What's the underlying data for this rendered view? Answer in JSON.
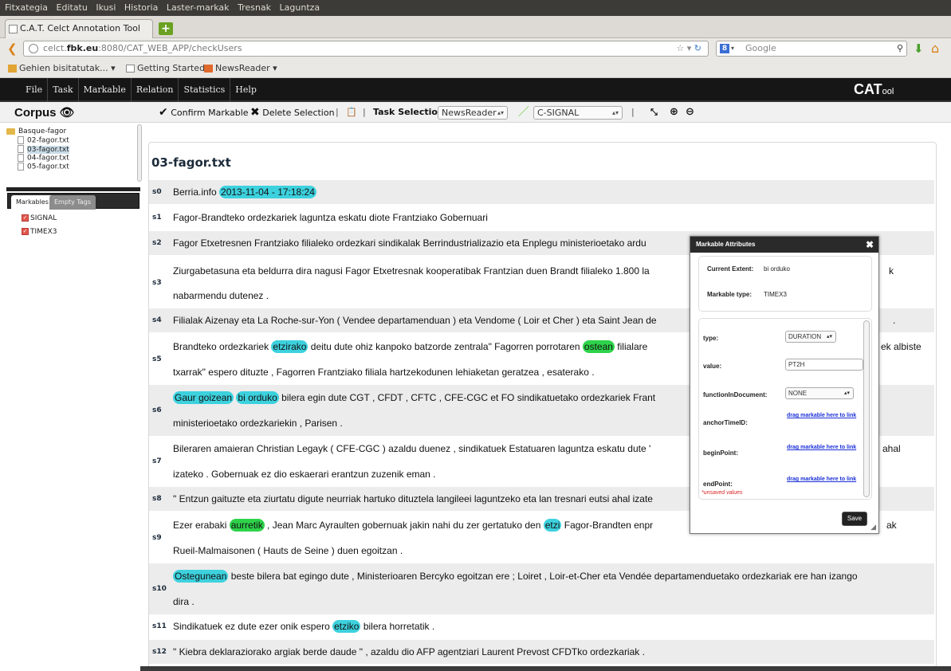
{
  "os_menu": [
    "Fitxategia",
    "Editatu",
    "Ikusi",
    "Historia",
    "Laster-markak",
    "Tresnak",
    "Laguntza"
  ],
  "browser": {
    "tab_title": "C.A.T. Celct Annotation Tool",
    "url_domain": "celct.",
    "url_host_bold": "fbk.eu",
    "url_rest": ":8080/CAT_WEB_APP/checkUsers",
    "search_placeholder": "Google",
    "bookmarks": [
      "Gehien bisitatutak...",
      "Getting Started",
      "NewsReader"
    ]
  },
  "app": {
    "menu": [
      "File",
      "Task",
      "Markable",
      "Relation",
      "Statistics",
      "Help"
    ],
    "logo_main": "CAT",
    "logo_sub": "ool"
  },
  "toolbar": {
    "corpus_label": "Corpus",
    "confirm": "Confirm Markable",
    "delete": "Delete Selection",
    "task_selection_label": "Task Selection",
    "task_value": "NewsReader",
    "markable_value": "C-SIGNAL"
  },
  "tree": {
    "folder": "Basque-fagor",
    "files": [
      "02-fagor.txt",
      "03-fagor.txt",
      "04-fagor.txt",
      "05-fagor.txt"
    ]
  },
  "side_tabs": {
    "markables": "Markables",
    "empty": "Empty Tags"
  },
  "markables": [
    "SIGNAL",
    "TIMEX3"
  ],
  "doc": {
    "title": "03-fagor.txt",
    "sentences": [
      {
        "id": "s0",
        "t1": "Berria.info ",
        "h1": "2013-11-04 - 17:18:24"
      },
      {
        "id": "s1",
        "t1": "Fagor-Brandteko ordezkariek laguntza eskatu diote Frantziako Gobernuari"
      },
      {
        "id": "s2",
        "t1": "Fagor Etxetresnen Frantziako filialeko ordezkari sindikalak Berrindustrializazio eta Enplegu ministerioetako ardu"
      },
      {
        "id": "s3",
        "t1": "Ziurgabetasuna eta beldurra dira nagusi Fagor Etxetresnak kooperatibak Frantzian duen Brandt filialeko 1.800 la",
        "t1b": "k",
        "t2": "nabarmendu dutenez ."
      },
      {
        "id": "s4",
        "t1": "Filialak Aizenay eta La Roche-sur-Yon ( Vendee departamenduan ) eta Vendome ( Loir et Cher ) eta Saint Jean de",
        "t1b": "."
      },
      {
        "id": "s5",
        "a": "Brandteko ordezkariek ",
        "h1": "etzirako",
        "b": " deitu dute ohiz kanpoko batzorde zentrala\" Fagorren porrotaren ",
        "h2": "ostean",
        "c": " filialare",
        "t1b": "ek albiste",
        "t2": "txarrak\" espero dituzte , Fagorren Frantziako filiala hartzekodunen lehiaketan geratzea , esaterako ."
      },
      {
        "id": "s6",
        "h1": "Gaur goizean",
        "h2": "bi orduko",
        "c": " bilera egin dute CGT , CFDT , CFTC , CFE-CGC et FO sindikatuetako ordezkariek Frant",
        "t2": "ministerioetako ordezkariekin , Parisen ."
      },
      {
        "id": "s7",
        "t1": "Bileraren amaieran Christian Legayk ( CFE-CGC ) azaldu duenez , sindikatuek Estatuaren laguntza eskatu dute '",
        "t1b": "ahal",
        "t2": "izateko . Gobernuak ez dio eskaerari erantzun zuzenik eman ."
      },
      {
        "id": "s8",
        "t1": "\" Entzun gaituzte eta ziurtatu digute neurriak hartuko dituztela langileei laguntzeko eta lan tresnari eutsi ahal izate"
      },
      {
        "id": "s9",
        "a": "Ezer erabaki ",
        "h1": "aurretik",
        "b": " , Jean Marc Ayraulten gobernuak jakin nahi du zer gertatuko den ",
        "h2": "etzi",
        "c": " Fagor-Brandten enpr",
        "t1b": "ak",
        "t2": "Rueil-Malmaisonen ( Hauts de Seine ) duen egoitzan ."
      },
      {
        "id": "s10",
        "h1": "Ostegunean",
        "c": " beste bilera bat egingo dute , Ministerioaren Bercyko egoitzan ere ; Loiret , Loir-et-Cher eta Vendée departamenduetako ordezkariak ere han izango",
        "t2": "dira ."
      },
      {
        "id": "s11",
        "a": "Sindikatuek ez dute ezer onik espero ",
        "h1": "etziko",
        "b": " bilera horretatik ."
      },
      {
        "id": "s12",
        "t1": "\" Kiebra deklaraziorako argiak berde daude \" , azaldu dio AFP agentziari Laurent Prevost CFDTko ordezkariak ."
      }
    ]
  },
  "popup": {
    "title": "Markable Attributes",
    "current_extent_label": "Current Extent:",
    "current_extent_value": "bi orduko",
    "markable_type_label": "Markable type:",
    "markable_type_value": "TIMEX3",
    "attributes": {
      "type_label": "type:",
      "type_value": "DURATION",
      "value_label": "value:",
      "value_value": "PT2H",
      "function_label": "functionInDocument:",
      "function_value": "NONE",
      "anchor_label": "anchorTimeID:",
      "begin_label": "beginPoint:",
      "end_label": "endPoint:",
      "link_text": "drag markable here to link"
    },
    "unsaved": "*unsaved values",
    "save": "Save"
  }
}
